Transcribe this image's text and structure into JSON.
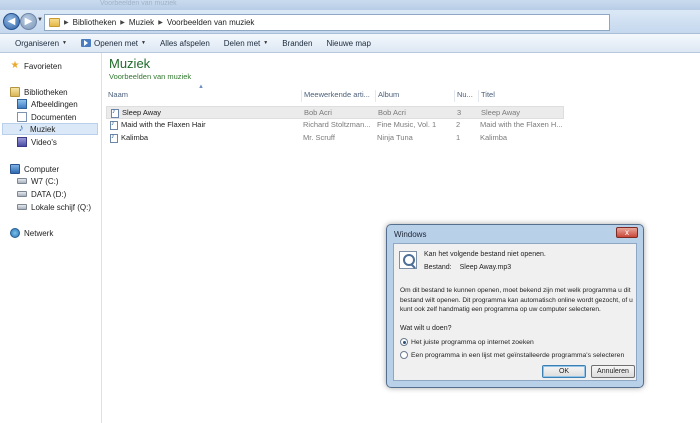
{
  "window": {
    "faint_title": "Voorbeelden van muziek"
  },
  "address": {
    "crumbs": [
      "Bibliotheken",
      "Muziek",
      "Voorbeelden van muziek"
    ]
  },
  "toolbar": {
    "organize": "Organiseren",
    "open_with": "Openen met",
    "play_all": "Alles afspelen",
    "share": "Delen met",
    "burn": "Branden",
    "new_folder": "Nieuwe map"
  },
  "sidebar": {
    "favorites": "Favorieten",
    "libraries": "Bibliotheken",
    "pictures": "Afbeeldingen",
    "documents": "Documenten",
    "music": "Muziek",
    "videos": "Video's",
    "computer": "Computer",
    "drive_c": "W7 (C:)",
    "drive_d": "DATA (D:)",
    "drive_q": "Lokale schijf (Q:)",
    "network": "Netwerk"
  },
  "library": {
    "title": "Muziek",
    "subtitle": "Voorbeelden van muziek"
  },
  "columns": {
    "name": "Naam",
    "artists": "Meewerkende arti...",
    "album": "Album",
    "number": "Nu...",
    "title": "Titel"
  },
  "files": [
    {
      "name": "Sleep Away",
      "artists": "Bob Acri",
      "album": "Bob Acri",
      "number": "3",
      "title": "Sleep Away"
    },
    {
      "name": "Maid with the Flaxen Hair",
      "artists": "Richard Stoltzman...",
      "album": "Fine Music, Vol. 1",
      "number": "2",
      "title": "Maid with the Flaxen H..."
    },
    {
      "name": "Kalimba",
      "artists": "Mr. Scruff",
      "album": "Ninja Tuna",
      "number": "1",
      "title": "Kalimba"
    }
  ],
  "dialog": {
    "title": "Windows",
    "close": "x",
    "message": "Kan het volgende bestand niet openen.",
    "file_label": "Bestand:",
    "file_value": "Sleep Away.mp3",
    "description": "Om dit bestand te kunnen openen, moet bekend zijn met welk programma u dit bestand wilt openen. Dit programma kan automatisch online wordt gezocht, of u kunt ook zelf handmatig een programma op uw computer selecteren.",
    "question": "Wat wilt u doen?",
    "option_web": "Het juiste programma op internet zoeken",
    "option_list": "Een programma in een lijst met geïnstalleerde programma's selecteren",
    "ok": "OK",
    "cancel": "Annuleren"
  }
}
